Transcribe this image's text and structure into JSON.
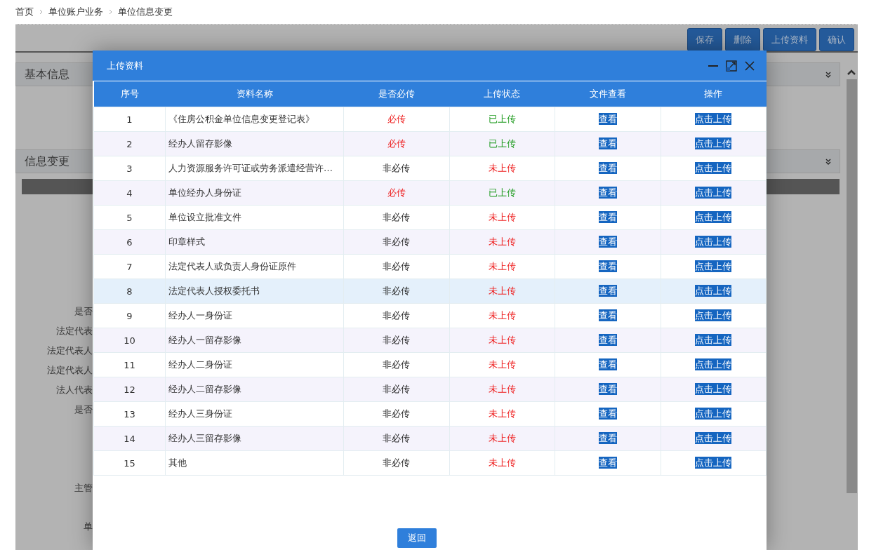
{
  "breadcrumb": [
    "首页",
    "单位账户业务",
    "单位信息变更"
  ],
  "toolbar": [
    "保存",
    "删除",
    "上传资料",
    "确认"
  ],
  "sections": [
    {
      "title": "基本信息"
    },
    {
      "title": "信息变更"
    }
  ],
  "background_labels": [
    "是否",
    "法定代表",
    "法定代表人",
    "法定代表人",
    "法人代表",
    "是否",
    "主管",
    "单"
  ],
  "dialog": {
    "title": "上传资料",
    "columns": [
      "序号",
      "资料名称",
      "是否必传",
      "上传状态",
      "文件查看",
      "操作"
    ],
    "rows": [
      {
        "no": "1",
        "name": "《住房公积金单位信息变更登记表》",
        "required": true,
        "required_text": "必传",
        "uploaded": true,
        "status": "已上传",
        "view": "查看",
        "action": "点击上传",
        "selected": false
      },
      {
        "no": "2",
        "name": "经办人留存影像",
        "required": true,
        "required_text": "必传",
        "uploaded": true,
        "status": "已上传",
        "view": "查看",
        "action": "点击上传",
        "selected": false
      },
      {
        "no": "3",
        "name": "人力资源服务许可证或劳务派遣经营许…",
        "required": false,
        "required_text": "非必传",
        "uploaded": false,
        "status": "未上传",
        "view": "查看",
        "action": "点击上传",
        "selected": false
      },
      {
        "no": "4",
        "name": "单位经办人身份证",
        "required": true,
        "required_text": "必传",
        "uploaded": true,
        "status": "已上传",
        "view": "查看",
        "action": "点击上传",
        "selected": false
      },
      {
        "no": "5",
        "name": "单位设立批准文件",
        "required": false,
        "required_text": "非必传",
        "uploaded": false,
        "status": "未上传",
        "view": "查看",
        "action": "点击上传",
        "selected": false
      },
      {
        "no": "6",
        "name": "印章样式",
        "required": false,
        "required_text": "非必传",
        "uploaded": false,
        "status": "未上传",
        "view": "查看",
        "action": "点击上传",
        "selected": false
      },
      {
        "no": "7",
        "name": "法定代表人或负责人身份证原件",
        "required": false,
        "required_text": "非必传",
        "uploaded": false,
        "status": "未上传",
        "view": "查看",
        "action": "点击上传",
        "selected": false
      },
      {
        "no": "8",
        "name": "法定代表人授权委托书",
        "required": false,
        "required_text": "非必传",
        "uploaded": false,
        "status": "未上传",
        "view": "查看",
        "action": "点击上传",
        "selected": true
      },
      {
        "no": "9",
        "name": "经办人一身份证",
        "required": false,
        "required_text": "非必传",
        "uploaded": false,
        "status": "未上传",
        "view": "查看",
        "action": "点击上传",
        "selected": false
      },
      {
        "no": "10",
        "name": "经办人一留存影像",
        "required": false,
        "required_text": "非必传",
        "uploaded": false,
        "status": "未上传",
        "view": "查看",
        "action": "点击上传",
        "selected": false
      },
      {
        "no": "11",
        "name": "经办人二身份证",
        "required": false,
        "required_text": "非必传",
        "uploaded": false,
        "status": "未上传",
        "view": "查看",
        "action": "点击上传",
        "selected": false
      },
      {
        "no": "12",
        "name": "经办人二留存影像",
        "required": false,
        "required_text": "非必传",
        "uploaded": false,
        "status": "未上传",
        "view": "查看",
        "action": "点击上传",
        "selected": false
      },
      {
        "no": "13",
        "name": "经办人三身份证",
        "required": false,
        "required_text": "非必传",
        "uploaded": false,
        "status": "未上传",
        "view": "查看",
        "action": "点击上传",
        "selected": false
      },
      {
        "no": "14",
        "name": "经办人三留存影像",
        "required": false,
        "required_text": "非必传",
        "uploaded": false,
        "status": "未上传",
        "view": "查看",
        "action": "点击上传",
        "selected": false
      },
      {
        "no": "15",
        "name": "其他",
        "required": false,
        "required_text": "非必传",
        "uploaded": false,
        "status": "未上传",
        "view": "查看",
        "action": "点击上传",
        "selected": false
      }
    ],
    "back_button": "返回"
  }
}
